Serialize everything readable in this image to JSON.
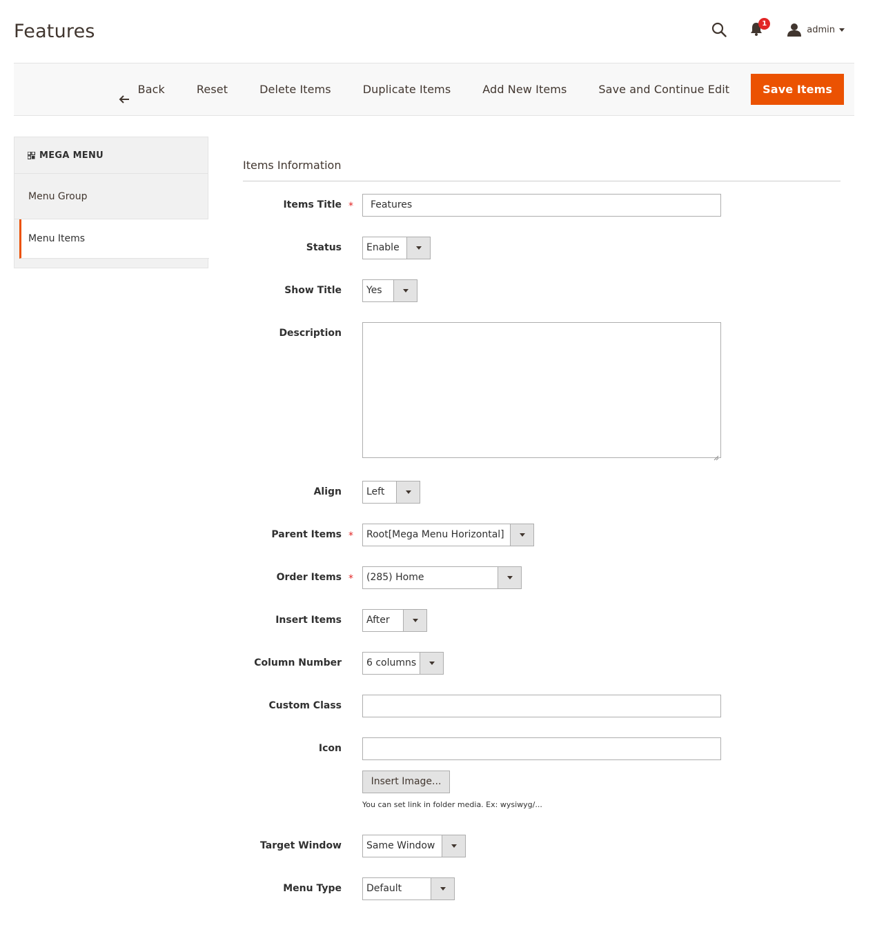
{
  "header": {
    "title": "Features",
    "notification_count": "1",
    "user_name": "admin"
  },
  "toolbar": {
    "back_label": "Back",
    "reset_label": "Reset",
    "delete_label": "Delete Items",
    "duplicate_label": "Duplicate Items",
    "add_new_label": "Add New Items",
    "save_continue_label": "Save and Continue Edit",
    "save_label": "Save Items"
  },
  "sidebar": {
    "title": "MEGA MENU",
    "items": [
      {
        "label": "Menu Group"
      },
      {
        "label": "Menu Items"
      }
    ]
  },
  "form": {
    "section_title": "Items Information",
    "items_title": {
      "label": "Items Title",
      "value": "Features"
    },
    "status": {
      "label": "Status",
      "value": "Enable"
    },
    "show_title": {
      "label": "Show Title",
      "value": "Yes"
    },
    "description": {
      "label": "Description",
      "value": ""
    },
    "align": {
      "label": "Align",
      "value": "Left"
    },
    "parent_items": {
      "label": "Parent Items",
      "value": "Root[Mega Menu Horizontal]"
    },
    "order_items": {
      "label": "Order Items",
      "value": "(285) Home"
    },
    "insert_items": {
      "label": "Insert Items",
      "value": "After"
    },
    "column_number": {
      "label": "Column Number",
      "value": "6 columns"
    },
    "custom_class": {
      "label": "Custom Class",
      "value": ""
    },
    "icon": {
      "label": "Icon",
      "value": "",
      "insert_button": "Insert Image...",
      "note": "You can set link in folder media. Ex: wysiwyg/..."
    },
    "target_window": {
      "label": "Target Window",
      "value": "Same Window"
    },
    "menu_type": {
      "label": "Menu Type",
      "value": "Default"
    }
  },
  "colors": {
    "accent": "#eb5202",
    "required": "#e22626"
  }
}
